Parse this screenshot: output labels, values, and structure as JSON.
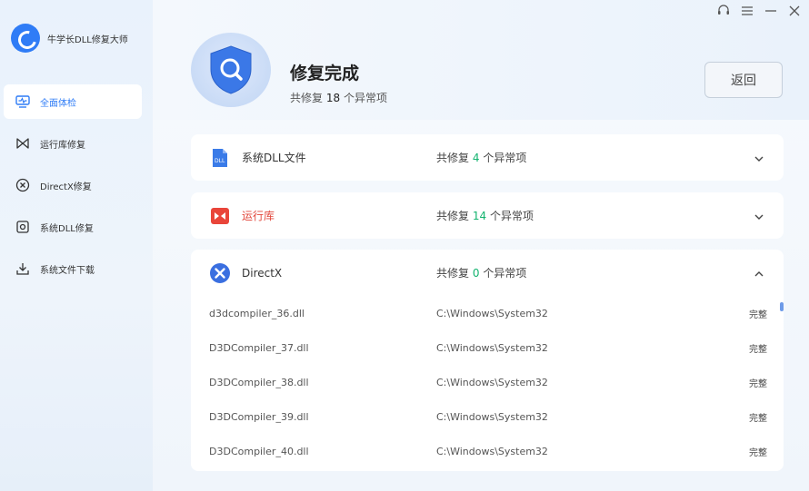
{
  "app": {
    "title": "牛学长DLL修复大师"
  },
  "sidebar": {
    "items": [
      {
        "label": "全面体检",
        "icon": "monitor-icon",
        "active": true
      },
      {
        "label": "运行库修复",
        "icon": "runtime-icon"
      },
      {
        "label": "DirectX修复",
        "icon": "directx-icon"
      },
      {
        "label": "系统DLL修复",
        "icon": "disk-icon"
      },
      {
        "label": "系统文件下载",
        "icon": "download-icon"
      }
    ]
  },
  "header": {
    "title": "修复完成",
    "sub_prefix": "共修复",
    "sub_count": "18",
    "sub_suffix": "个异常项",
    "back_label": "返回"
  },
  "categories": [
    {
      "name": "系统DLL文件",
      "prefix": "共修复",
      "count": "4",
      "suffix": "个异常项",
      "icon": "dll-icon",
      "expanded": false
    },
    {
      "name": "运行库",
      "prefix": "共修复",
      "count": "14",
      "suffix": "个异常项",
      "icon": "runtime-red-icon",
      "expanded": false
    },
    {
      "name": "DirectX",
      "prefix": "共修复",
      "count": "0",
      "suffix": "个异常项",
      "icon": "directx-blue-icon",
      "expanded": true
    }
  ],
  "files": [
    {
      "name": "d3dcompiler_36.dll",
      "path": "C:\\Windows\\System32",
      "status": "完整"
    },
    {
      "name": "D3DCompiler_37.dll",
      "path": "C:\\Windows\\System32",
      "status": "完整"
    },
    {
      "name": "D3DCompiler_38.dll",
      "path": "C:\\Windows\\System32",
      "status": "完整"
    },
    {
      "name": "D3DCompiler_39.dll",
      "path": "C:\\Windows\\System32",
      "status": "完整"
    },
    {
      "name": "D3DCompiler_40.dll",
      "path": "C:\\Windows\\System32",
      "status": "完整"
    }
  ],
  "colors": {
    "accent": "#2f7cf6",
    "success": "#13b36f",
    "danger": "#e2473b"
  }
}
